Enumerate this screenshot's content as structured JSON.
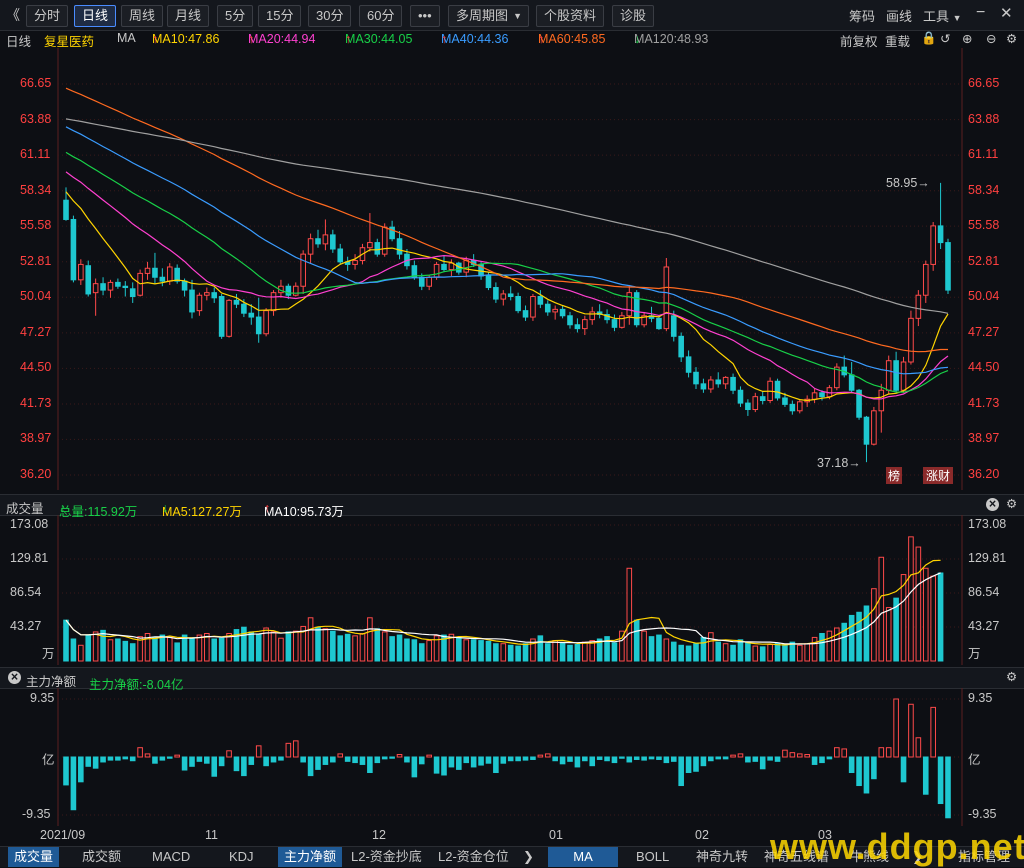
{
  "toolbar": {
    "back_glyph": "《",
    "tabs": [
      "分时",
      "日线",
      "周线",
      "月线",
      "5分",
      "15分",
      "30分",
      "60分",
      "•••",
      "多周期图",
      "个股资料",
      "诊股"
    ],
    "active_tab": "日线",
    "right_items": [
      "筹码",
      "画线",
      "工具"
    ]
  },
  "ma_line": {
    "period": "日线",
    "stock_name": "复星医药",
    "ma_label": "MA",
    "ma10": "MA10:47.86",
    "ma20": "MA20:44.94",
    "ma30": "MA30:44.05",
    "ma40": "MA40:44.36",
    "ma60": "MA60:45.85",
    "ma120": "MA120:48.93",
    "right_items": [
      "前复权",
      "重载"
    ],
    "colors": {
      "ma10": "#ffd400",
      "ma20": "#ff40d0",
      "ma30": "#18d048",
      "ma40": "#3a9cff",
      "ma60": "#ff6a20",
      "ma120": "#a0a0a0"
    }
  },
  "price_axis": [
    "66.65",
    "63.88",
    "61.11",
    "58.34",
    "55.58",
    "52.81",
    "50.04",
    "47.27",
    "44.50",
    "41.73",
    "38.97",
    "36.20"
  ],
  "annotations": {
    "high": "58.95→",
    "low": "37.18→",
    "badge1": "榜",
    "badge2": "涨财"
  },
  "volume_panel": {
    "title": "成交量",
    "total": "总量:115.92万",
    "ma5": "MA5:127.27万",
    "ma10": "MA10:95.73万",
    "axis": [
      "173.08",
      "129.81",
      "86.54",
      "43.27",
      "万"
    ]
  },
  "fund_panel": {
    "title": "主力净额",
    "value": "主力净额:-8.04亿",
    "axis": [
      "9.35",
      "亿",
      "-9.35"
    ]
  },
  "date_axis": [
    "2021/09",
    "11",
    "12",
    "01",
    "02",
    "03"
  ],
  "bottom_tabs_left": [
    "成交量",
    "成交额",
    "MACD",
    "KDJ",
    "主力净额",
    "L2-资金抄底",
    "L2-资金仓位"
  ],
  "bottom_tabs_right": [
    "MA",
    "BOLL",
    "神奇九转",
    "神奇五线谱",
    "牛熊线",
    "指标管理"
  ],
  "watermark": "www.ddgp.net",
  "chart_data": {
    "type": "candlestick",
    "note_series": [
      "candles",
      "volume",
      "net_fund"
    ],
    "candles_ohlc": [
      [
        57.6,
        58.6,
        56.0,
        56.1
      ],
      [
        56.1,
        56.4,
        51.2,
        51.4
      ],
      [
        51.4,
        53.0,
        51.0,
        52.6
      ],
      [
        52.5,
        52.9,
        50.1,
        50.3
      ],
      [
        50.4,
        51.5,
        48.6,
        51.1
      ],
      [
        51.1,
        51.6,
        50.2,
        50.6
      ],
      [
        50.6,
        51.4,
        50.0,
        51.2
      ],
      [
        51.2,
        51.5,
        50.7,
        50.9
      ],
      [
        50.9,
        51.3,
        50.1,
        50.8
      ],
      [
        50.7,
        51.2,
        49.6,
        50.1
      ],
      [
        50.2,
        52.2,
        50.1,
        51.9
      ],
      [
        51.9,
        52.8,
        51.4,
        52.3
      ],
      [
        52.3,
        53.5,
        51.1,
        51.6
      ],
      [
        51.6,
        52.3,
        50.9,
        51.3
      ],
      [
        51.3,
        52.7,
        51.0,
        52.4
      ],
      [
        52.3,
        52.6,
        51.1,
        51.3
      ],
      [
        51.3,
        51.5,
        50.1,
        50.6
      ],
      [
        50.6,
        51.4,
        48.4,
        48.9
      ],
      [
        49.0,
        50.4,
        48.6,
        50.2
      ],
      [
        50.2,
        50.8,
        49.8,
        50.4
      ],
      [
        50.4,
        50.8,
        49.6,
        50.0
      ],
      [
        50.1,
        50.3,
        46.8,
        47.0
      ],
      [
        47.0,
        49.9,
        46.9,
        49.8
      ],
      [
        49.8,
        50.3,
        49.2,
        49.5
      ],
      [
        49.5,
        49.9,
        48.5,
        48.8
      ],
      [
        48.8,
        49.5,
        47.9,
        48.5
      ],
      [
        48.5,
        50.0,
        46.5,
        47.2
      ],
      [
        47.2,
        49.2,
        47.0,
        49.0
      ],
      [
        49.0,
        50.6,
        48.6,
        50.4
      ],
      [
        50.4,
        51.4,
        50.0,
        50.9
      ],
      [
        50.9,
        51.1,
        49.9,
        50.2
      ],
      [
        50.2,
        51.2,
        50.1,
        50.9
      ],
      [
        50.9,
        53.7,
        50.3,
        53.4
      ],
      [
        53.4,
        55.0,
        52.7,
        54.6
      ],
      [
        54.6,
        55.3,
        53.9,
        54.2
      ],
      [
        54.2,
        56.1,
        53.7,
        54.9
      ],
      [
        54.9,
        55.3,
        53.5,
        53.8
      ],
      [
        53.8,
        54.2,
        52.6,
        52.8
      ],
      [
        52.8,
        53.2,
        52.1,
        52.6
      ],
      [
        52.6,
        53.4,
        52.2,
        52.9
      ],
      [
        52.9,
        54.2,
        52.6,
        53.9
      ],
      [
        53.9,
        56.6,
        53.6,
        54.3
      ],
      [
        54.3,
        54.6,
        53.2,
        53.4
      ],
      [
        53.4,
        55.8,
        53.2,
        55.5
      ],
      [
        55.5,
        56.0,
        54.4,
        54.6
      ],
      [
        54.6,
        55.2,
        53.0,
        53.4
      ],
      [
        53.4,
        53.8,
        52.2,
        52.5
      ],
      [
        52.5,
        52.9,
        51.4,
        51.6
      ],
      [
        51.6,
        51.9,
        50.6,
        50.9
      ],
      [
        50.9,
        51.8,
        50.6,
        51.6
      ],
      [
        51.6,
        52.8,
        51.4,
        52.6
      ],
      [
        52.6,
        53.3,
        52.0,
        52.2
      ],
      [
        52.2,
        53.0,
        51.7,
        52.7
      ],
      [
        52.7,
        52.8,
        51.8,
        52.0
      ],
      [
        52.0,
        53.2,
        51.6,
        52.9
      ],
      [
        52.9,
        53.4,
        52.4,
        52.6
      ],
      [
        52.6,
        52.8,
        51.4,
        51.7
      ],
      [
        51.7,
        52.0,
        50.6,
        50.8
      ],
      [
        50.8,
        51.2,
        49.6,
        49.9
      ],
      [
        49.9,
        50.6,
        49.4,
        50.3
      ],
      [
        50.3,
        50.9,
        49.8,
        50.1
      ],
      [
        50.1,
        50.4,
        48.8,
        49.0
      ],
      [
        49.0,
        49.4,
        48.2,
        48.5
      ],
      [
        48.5,
        50.3,
        48.2,
        50.1
      ],
      [
        50.1,
        50.6,
        49.2,
        49.5
      ],
      [
        49.5,
        49.8,
        48.6,
        48.9
      ],
      [
        48.9,
        49.4,
        48.3,
        49.1
      ],
      [
        49.1,
        49.4,
        48.4,
        48.6
      ],
      [
        48.6,
        48.9,
        47.6,
        47.9
      ],
      [
        47.9,
        48.4,
        47.3,
        47.6
      ],
      [
        47.6,
        48.6,
        47.1,
        48.3
      ],
      [
        48.3,
        49.3,
        47.9,
        48.9
      ],
      [
        48.9,
        49.5,
        48.4,
        48.7
      ],
      [
        48.7,
        49.1,
        48.0,
        48.3
      ],
      [
        48.3,
        48.7,
        47.4,
        47.7
      ],
      [
        47.7,
        48.9,
        47.6,
        48.6
      ],
      [
        48.6,
        51.0,
        47.9,
        50.4
      ],
      [
        50.4,
        50.6,
        47.7,
        47.9
      ],
      [
        47.9,
        48.9,
        47.7,
        48.6
      ],
      [
        48.6,
        49.3,
        48.1,
        48.4
      ],
      [
        48.4,
        48.6,
        47.5,
        47.6
      ],
      [
        47.6,
        53.1,
        47.4,
        52.4
      ],
      [
        48.6,
        49.0,
        46.6,
        47.0
      ],
      [
        47.0,
        47.3,
        45.0,
        45.4
      ],
      [
        45.4,
        45.9,
        43.8,
        44.2
      ],
      [
        44.2,
        44.6,
        42.9,
        43.3
      ],
      [
        43.3,
        43.7,
        42.6,
        42.9
      ],
      [
        42.9,
        43.9,
        42.6,
        43.6
      ],
      [
        43.6,
        44.2,
        43.0,
        43.3
      ],
      [
        43.3,
        43.9,
        42.9,
        43.8
      ],
      [
        43.8,
        44.1,
        42.5,
        42.8
      ],
      [
        42.8,
        43.1,
        41.5,
        41.8
      ],
      [
        41.8,
        42.1,
        40.8,
        41.3
      ],
      [
        41.3,
        42.6,
        41.1,
        42.3
      ],
      [
        42.3,
        42.7,
        41.7,
        42.0
      ],
      [
        42.0,
        43.8,
        41.8,
        43.5
      ],
      [
        43.5,
        43.7,
        42.0,
        42.2
      ],
      [
        42.2,
        42.6,
        41.5,
        41.7
      ],
      [
        41.7,
        42.0,
        40.9,
        41.2
      ],
      [
        41.2,
        42.1,
        41.0,
        41.9
      ],
      [
        41.9,
        42.4,
        41.5,
        42.1
      ],
      [
        42.1,
        42.9,
        41.8,
        42.6
      ],
      [
        42.6,
        42.8,
        42.0,
        42.3
      ],
      [
        42.3,
        43.2,
        42.1,
        43.0
      ],
      [
        43.0,
        44.9,
        42.8,
        44.6
      ],
      [
        44.6,
        45.5,
        43.8,
        44.0
      ],
      [
        44.0,
        45.0,
        42.6,
        42.8
      ],
      [
        42.8,
        42.9,
        40.5,
        40.7
      ],
      [
        40.7,
        40.8,
        37.2,
        38.6
      ],
      [
        38.6,
        41.5,
        38.5,
        41.2
      ],
      [
        41.2,
        43.3,
        39.5,
        42.8
      ],
      [
        42.8,
        45.5,
        42.5,
        45.1
      ],
      [
        45.1,
        45.8,
        42.6,
        42.8
      ],
      [
        42.8,
        45.4,
        42.6,
        45.0
      ],
      [
        45.0,
        49.0,
        44.8,
        48.4
      ],
      [
        48.4,
        50.6,
        47.8,
        50.2
      ],
      [
        50.2,
        52.9,
        49.6,
        52.6
      ],
      [
        52.6,
        55.9,
        52.1,
        55.6
      ],
      [
        55.6,
        58.95,
        53.8,
        54.3
      ],
      [
        54.3,
        54.6,
        50.3,
        50.6
      ]
    ],
    "volume_wan": [
      52,
      28,
      20,
      33,
      37,
      39,
      27,
      28,
      25,
      22,
      31,
      35,
      30,
      33,
      30,
      23,
      33,
      29,
      33,
      35,
      28,
      29,
      35,
      40,
      43,
      37,
      34,
      42,
      37,
      29,
      37,
      38,
      44,
      55,
      43,
      41,
      38,
      32,
      34,
      32,
      35,
      55,
      41,
      37,
      31,
      33,
      28,
      27,
      22,
      26,
      32,
      33,
      34,
      30,
      27,
      27,
      26,
      25,
      22,
      22,
      20,
      19,
      22,
      28,
      32,
      22,
      26,
      23,
      20,
      21,
      24,
      26,
      28,
      31,
      23,
      38,
      118,
      52,
      38,
      31,
      33,
      28,
      24,
      20,
      19,
      22,
      30,
      36,
      24,
      22,
      20,
      27,
      23,
      19,
      18,
      21,
      23,
      21,
      24,
      20,
      22,
      30,
      35,
      38,
      42,
      48,
      58,
      62,
      70,
      92,
      132,
      68,
      80,
      110,
      158,
      145,
      118,
      108,
      112
    ],
    "net_fund_yi": [
      -4.5,
      -8.5,
      -4.0,
      -1.5,
      -1.8,
      -0.8,
      -0.5,
      -0.5,
      -0.3,
      -0.6,
      1.5,
      0.5,
      -1.0,
      -0.5,
      -0.2,
      0.3,
      -2.1,
      -1.5,
      -0.7,
      -1.0,
      -3.1,
      -1.4,
      1.0,
      -2.2,
      -3.0,
      -1.2,
      1.8,
      -1.4,
      -0.8,
      -0.5,
      2.2,
      2.6,
      -0.8,
      -3.0,
      -2.0,
      -1.2,
      -0.8,
      0.5,
      -0.7,
      -0.9,
      -1.2,
      -2.5,
      -0.9,
      -0.3,
      -0.2,
      0.4,
      -0.8,
      -3.2,
      -1.1,
      0.3,
      -2.6,
      -2.9,
      -1.6,
      -2.0,
      -0.9,
      -1.6,
      -1.3,
      -1.0,
      -2.5,
      -1.0,
      -0.6,
      -0.6,
      -0.5,
      -0.4,
      0.3,
      0.5,
      -0.6,
      -1.1,
      -0.7,
      -1.6,
      -0.6,
      -1.4,
      -0.4,
      -0.6,
      -0.9,
      -0.2,
      -0.8,
      -0.4,
      -0.5,
      -0.3,
      -0.4,
      -0.9,
      -0.7,
      -4.6,
      -2.5,
      -2.3,
      -1.4,
      -0.6,
      -0.3,
      -0.3,
      0.3,
      0.5,
      -0.8,
      -0.7,
      -1.9,
      -0.5,
      -0.7,
      1.1,
      0.7,
      0.5,
      0.4,
      -1.2,
      -0.9,
      -0.3,
      1.5,
      1.3,
      -2.5,
      -4.6,
      -5.8,
      -3.5,
      1.5,
      1.5,
      9.35,
      -4.0,
      8.5,
      3.1,
      -6.0,
      8.0,
      -7.5,
      -9.8
    ]
  }
}
